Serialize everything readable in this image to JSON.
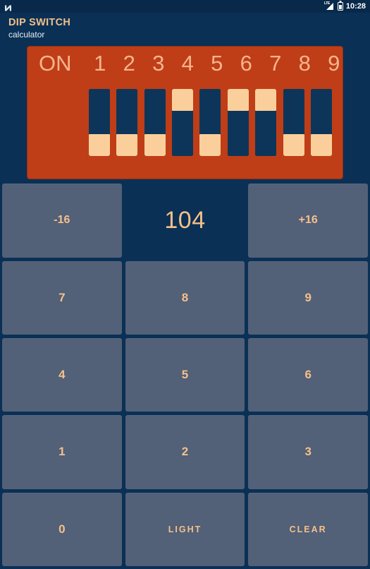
{
  "statusbar": {
    "notification_icon": "n-logo-icon",
    "signal_icon": "lte-signal-icon",
    "signal_label": "LTE",
    "battery_icon": "battery-icon",
    "time": "10:28"
  },
  "header": {
    "title": "DIP SWITCH",
    "subtitle": "calculator"
  },
  "dip": {
    "on_label": "ON",
    "panel_color": "#bf3e17",
    "knob_color": "#fbcf9b",
    "switches": [
      {
        "label": "1",
        "state": "off"
      },
      {
        "label": "2",
        "state": "off"
      },
      {
        "label": "3",
        "state": "off"
      },
      {
        "label": "4",
        "state": "on"
      },
      {
        "label": "5",
        "state": "off"
      },
      {
        "label": "6",
        "state": "on"
      },
      {
        "label": "7",
        "state": "on"
      },
      {
        "label": "8",
        "state": "off"
      },
      {
        "label": "9",
        "state": "off"
      }
    ]
  },
  "display": {
    "value": "104",
    "decrement_label": "-16",
    "increment_label": "+16"
  },
  "keypad": {
    "rows": [
      [
        {
          "name": "key-7",
          "label": "7",
          "style": "digit"
        },
        {
          "name": "key-8",
          "label": "8",
          "style": "digit"
        },
        {
          "name": "key-9",
          "label": "9",
          "style": "digit"
        }
      ],
      [
        {
          "name": "key-4",
          "label": "4",
          "style": "digit"
        },
        {
          "name": "key-5",
          "label": "5",
          "style": "digit"
        },
        {
          "name": "key-6",
          "label": "6",
          "style": "digit"
        }
      ],
      [
        {
          "name": "key-1",
          "label": "1",
          "style": "digit"
        },
        {
          "name": "key-2",
          "label": "2",
          "style": "digit"
        },
        {
          "name": "key-3",
          "label": "3",
          "style": "digit"
        }
      ],
      [
        {
          "name": "key-0",
          "label": "0",
          "style": "digit"
        },
        {
          "name": "light-button",
          "label": "LIGHT",
          "style": "word"
        },
        {
          "name": "clear-button",
          "label": "CLEAR",
          "style": "word"
        }
      ]
    ]
  },
  "colors": {
    "background": "#0a3055",
    "button_face": "#526078",
    "accent_text": "#f5c08a",
    "panel": "#bf3e17",
    "title": "#f0c08a"
  }
}
